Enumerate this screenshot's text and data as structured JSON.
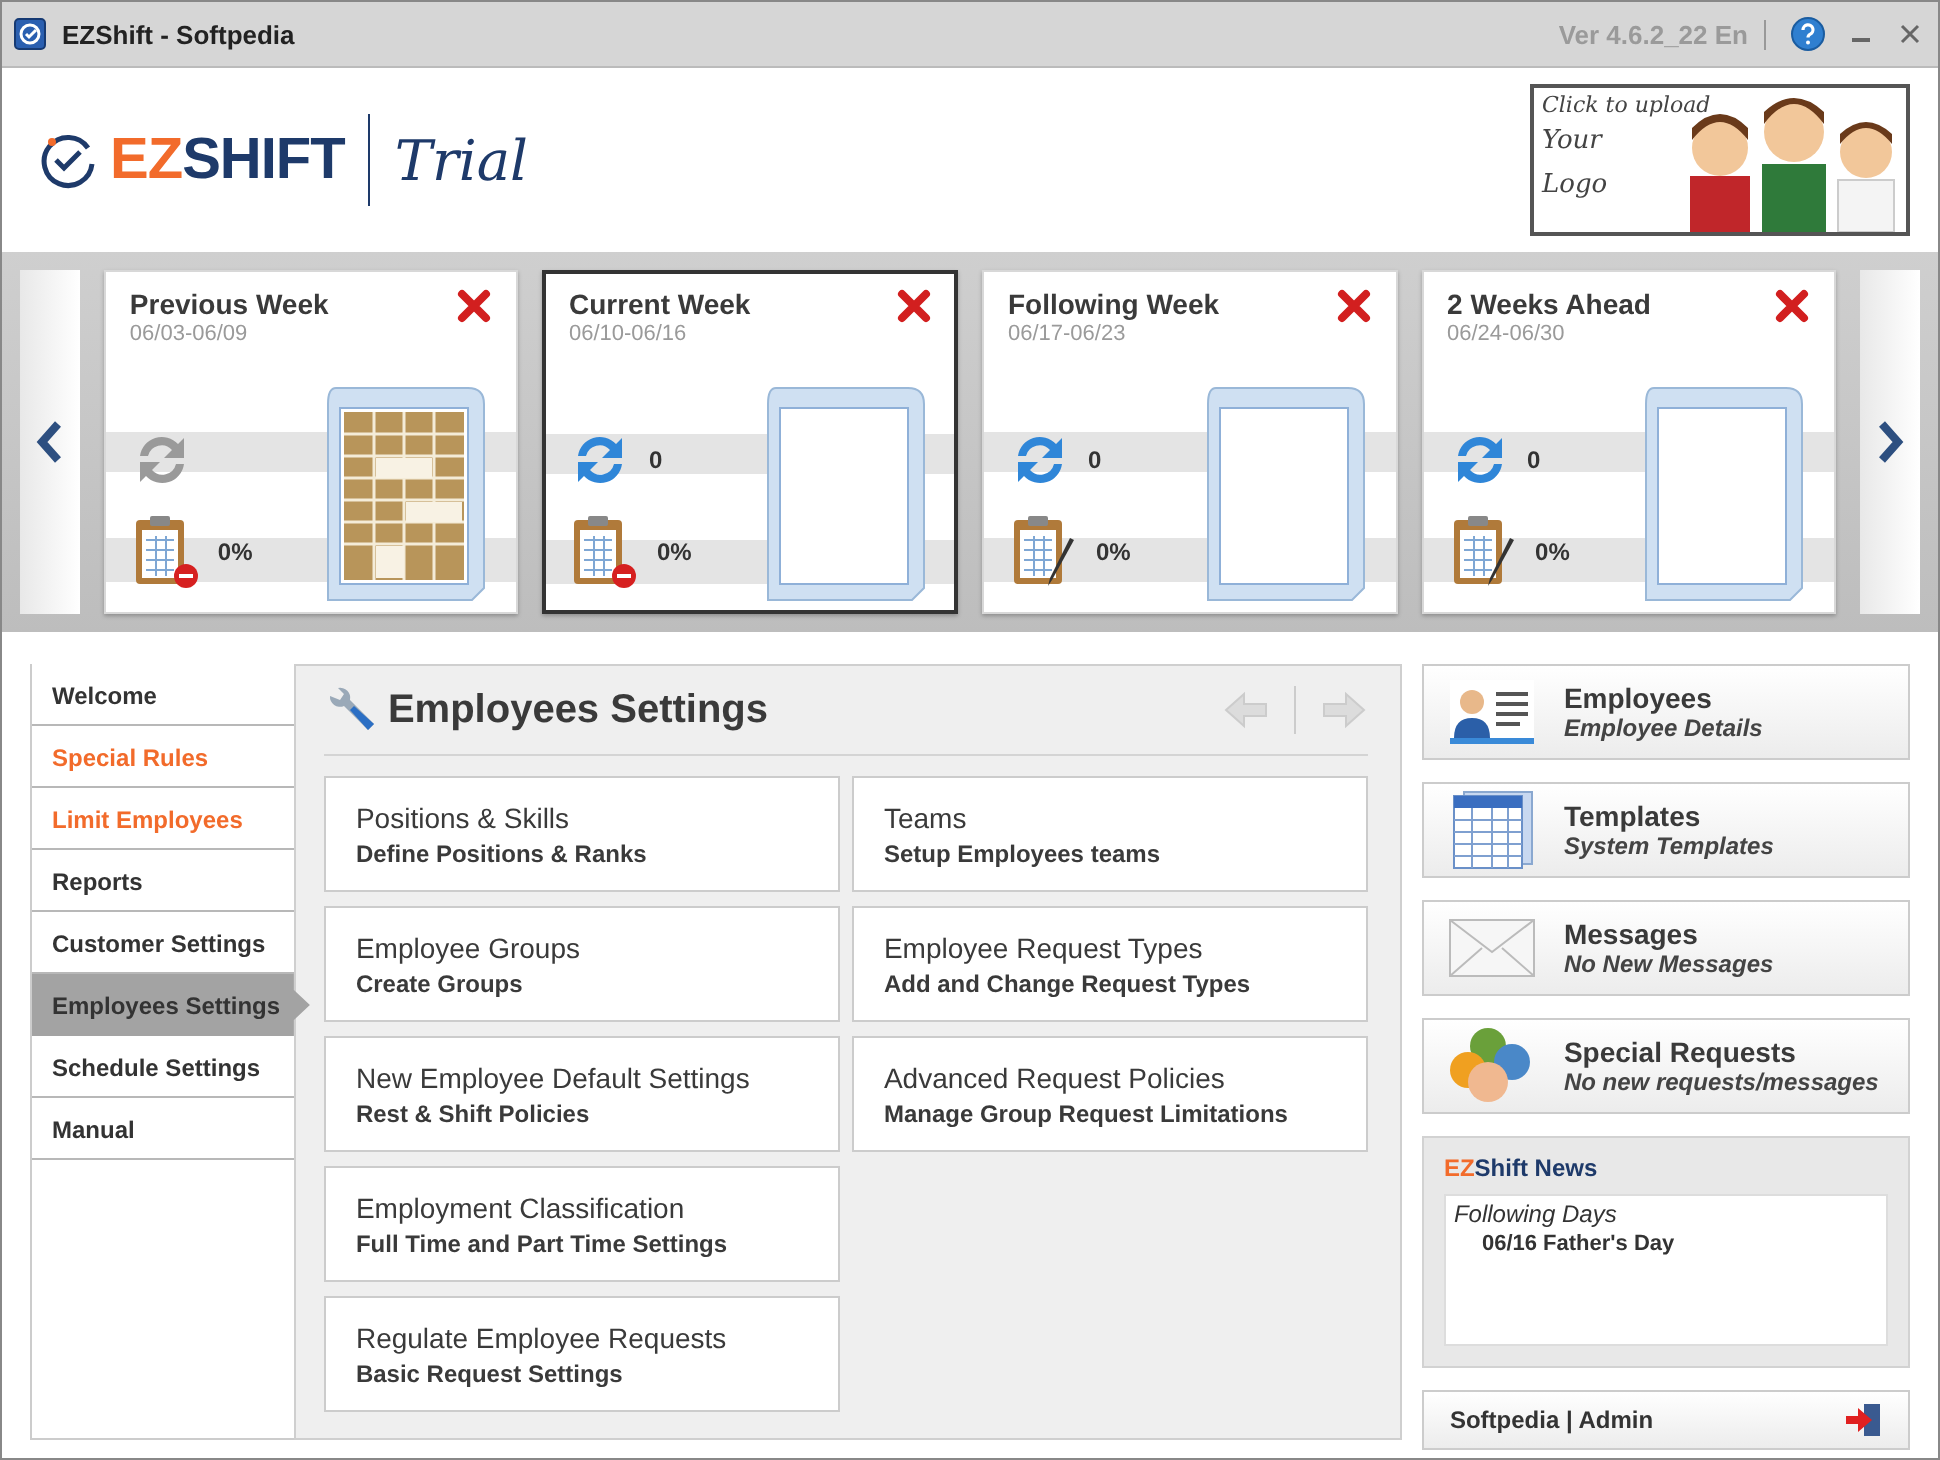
{
  "window": {
    "title": "EZShift -  Softpedia",
    "version": "Ver 4.6.2_22 En"
  },
  "header": {
    "logo_brand": "EZ",
    "logo_name": "SHIFT",
    "edition": "Trial",
    "upload_lines": [
      "Click to upload",
      "Your",
      "Logo"
    ]
  },
  "weeks": [
    {
      "title": "Previous Week",
      "dates": "06/03-06/09",
      "percent": "0%",
      "selected": false,
      "filled": true,
      "locked": true
    },
    {
      "title": "Current Week",
      "dates": "06/10-06/16",
      "count": "0",
      "percent": "0%",
      "selected": true,
      "filled": false,
      "locked": true
    },
    {
      "title": "Following Week",
      "dates": "06/17-06/23",
      "count": "0",
      "percent": "0%",
      "selected": false,
      "filled": false,
      "locked": false
    },
    {
      "title": "2 Weeks Ahead",
      "dates": "06/24-06/30",
      "count": "0",
      "percent": "0%",
      "selected": false,
      "filled": false,
      "locked": false
    }
  ],
  "sidebar": {
    "items": [
      {
        "label": "Welcome",
        "selected": false,
        "highlighted": false
      },
      {
        "label": "Special Rules",
        "selected": false,
        "highlighted": true
      },
      {
        "label": "Limit Employees",
        "selected": false,
        "highlighted": true
      },
      {
        "label": "Reports",
        "selected": false,
        "highlighted": false
      },
      {
        "label": "Customer Settings",
        "selected": false,
        "highlighted": false
      },
      {
        "label": "Employees Settings",
        "selected": true,
        "highlighted": false
      },
      {
        "label": "Schedule Settings",
        "selected": false,
        "highlighted": false
      },
      {
        "label": "Manual",
        "selected": false,
        "highlighted": false
      }
    ]
  },
  "settings": {
    "title": "Employees Settings",
    "tiles": [
      {
        "title": "Positions & Skills",
        "subtitle": "Define Positions & Ranks"
      },
      {
        "title": "Employee Groups",
        "subtitle": "Create Groups"
      },
      {
        "title": "New Employee Default Settings",
        "subtitle": "Rest & Shift Policies"
      },
      {
        "title": "Employment Classification",
        "subtitle": "Full Time and Part Time Settings"
      },
      {
        "title": "Regulate Employee Requests",
        "subtitle": "Basic Request Settings"
      },
      {
        "title": "Teams",
        "subtitle": "Setup Employees teams"
      },
      {
        "title": "Employee Request Types",
        "subtitle": "Add and Change Request Types"
      },
      {
        "title": "Advanced Request Policies",
        "subtitle": "Manage Group Request Limitations"
      }
    ]
  },
  "shortcuts": [
    {
      "kind": "employees",
      "title": "Employees",
      "subtitle": "Employee Details"
    },
    {
      "kind": "templates",
      "title": "Templates",
      "subtitle": "System Templates"
    },
    {
      "kind": "messages",
      "title": "Messages",
      "subtitle": "No New Messages"
    },
    {
      "kind": "requests",
      "title": "Special Requests",
      "subtitle": "No new requests/messages"
    }
  ],
  "news": {
    "brand": "EZ",
    "title": "Shift News",
    "heading": "Following Days",
    "items": [
      "06/16 Father's Day"
    ]
  },
  "footer": {
    "user": "Softpedia | Admin"
  }
}
